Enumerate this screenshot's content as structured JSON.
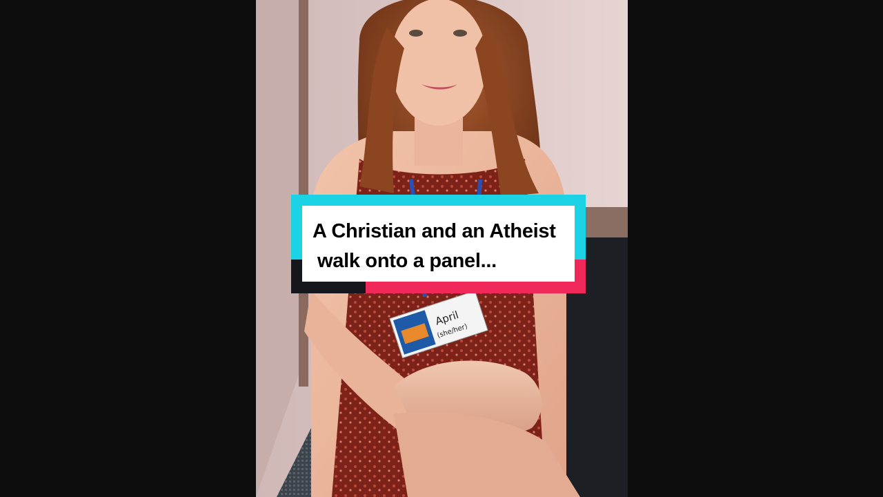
{
  "caption": {
    "line1": "A Christian and an Atheist",
    "line2": "walk onto a panel..."
  },
  "badge": {
    "name": "April",
    "pronouns": "(she/her)"
  },
  "colors": {
    "background": "#0d0d0d",
    "caption_accent_cyan": "#1cd3e6",
    "caption_accent_red": "#f0285a",
    "caption_accent_dark": "#15171d",
    "caption_panel": "#ffffff",
    "caption_text": "#000000"
  }
}
